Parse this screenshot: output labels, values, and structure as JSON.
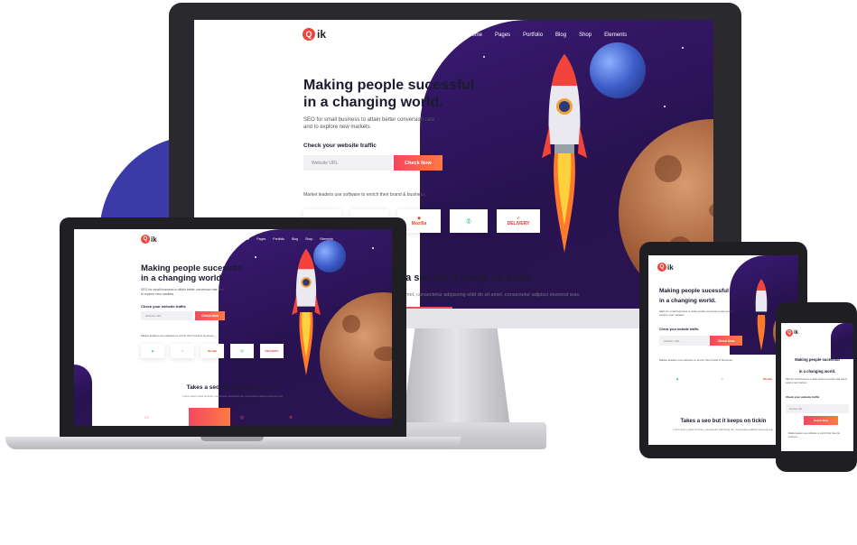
{
  "site": {
    "logo_letter": "Q",
    "logo_text": "ik",
    "nav": [
      "Home",
      "Pages",
      "Portfolio",
      "Blog",
      "Shop",
      "Elements"
    ],
    "headline_line1": "Making people sucessful",
    "headline_line2": "in a changing world.",
    "subtext": "SEO for small business to attain better conversion rate and to explore new markets",
    "check_label": "Check your website traffic",
    "url_placeholder": "Website URL",
    "check_button": "Check Now",
    "market_text": "Market leaders use software to enrich their brand & business.",
    "brands": [
      "Mozilla",
      "DELIVERY"
    ],
    "section_title": "Takes a seo but it keeps on tickin",
    "section_title_partial": "s a seo but it keeps on tickin",
    "section_text": "Lorem ipsum dolor sit amet, consectetur adipiscing elit, consectetur adipisci eiusmod euis.",
    "section_text_partial": "amet, consectetur adipiscing elitd do sit amet, consectetur adipisci eiusmod euis."
  },
  "colors": {
    "accent": "#f4475e",
    "space": "#2d1558",
    "blob": "#3b3aa8"
  }
}
